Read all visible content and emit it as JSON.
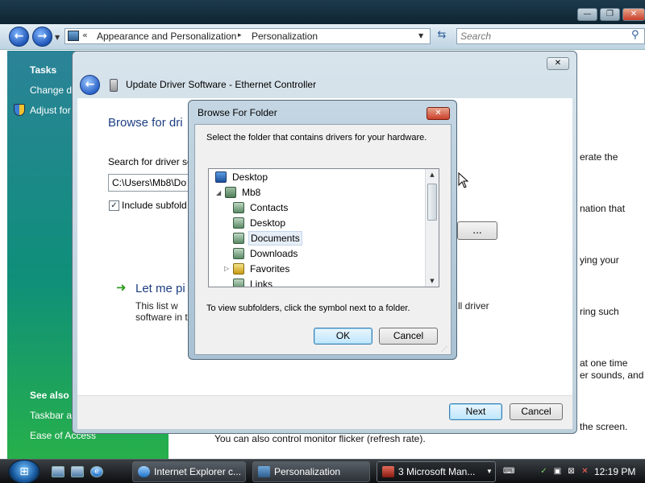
{
  "explorer": {
    "breadcrumb": [
      "Appearance and Personalization",
      "Personalization"
    ],
    "search_placeholder": "Search",
    "window_controls": {
      "minimize": "—",
      "restore": "❐",
      "close": "✕"
    },
    "sidebar": {
      "tasks_heading": "Tasks",
      "items": [
        "Change d",
        "Adjust for"
      ],
      "see_also_heading": "See also",
      "see_also_items": [
        "Taskbar a",
        "Ease of Access"
      ]
    },
    "body_fragments": [
      "erate the",
      "nation that",
      "ying your",
      "ring such",
      "at one time",
      "er sounds, and",
      "the screen.",
      "You can also control monitor flicker (refresh rate)."
    ]
  },
  "update_driver": {
    "title": "Update Driver Software - Ethernet Controller",
    "heading": "Browse for dri",
    "search_label": "Search for driver so",
    "path_value": "C:\\Users\\Mb8\\Do",
    "include_subfolders_label": "Include subfold",
    "include_subfolders_checked": true,
    "browse_label": "...",
    "let_me_pick_title": "Let me pi",
    "list_text_lines": [
      "This list w",
      "software in t"
    ],
    "list_text_tail": "ll driver",
    "next_label": "Next",
    "cancel_label": "Cancel"
  },
  "browse_folder": {
    "title": "Browse For Folder",
    "instruction": "Select the folder that contains drivers for your hardware.",
    "tree": [
      {
        "label": "Desktop",
        "icon": "desktop-icon"
      },
      {
        "label": "Mb8",
        "icon": "user-folder-icon"
      },
      {
        "label": "Contacts",
        "icon": "contacts-folder-icon"
      },
      {
        "label": "Desktop",
        "icon": "desktop-folder-icon"
      },
      {
        "label": "Documents",
        "icon": "documents-folder-icon",
        "selected": true
      },
      {
        "label": "Downloads",
        "icon": "downloads-folder-icon"
      },
      {
        "label": "Favorites",
        "icon": "favorites-folder-icon"
      },
      {
        "label": "Links",
        "icon": "links-folder-icon"
      }
    ],
    "hint": "To view subfolders, click the symbol next to a folder.",
    "ok_label": "OK",
    "cancel_label": "Cancel"
  },
  "taskbar": {
    "tasks": [
      {
        "label": "Internet Explorer c...",
        "icon": "internet-explorer-icon"
      },
      {
        "label": "Personalization",
        "icon": "control-panel-icon"
      },
      {
        "label": "3 Microsoft Man...",
        "icon": "mmc-icon",
        "active": true
      }
    ],
    "clock": "12:19 PM"
  }
}
